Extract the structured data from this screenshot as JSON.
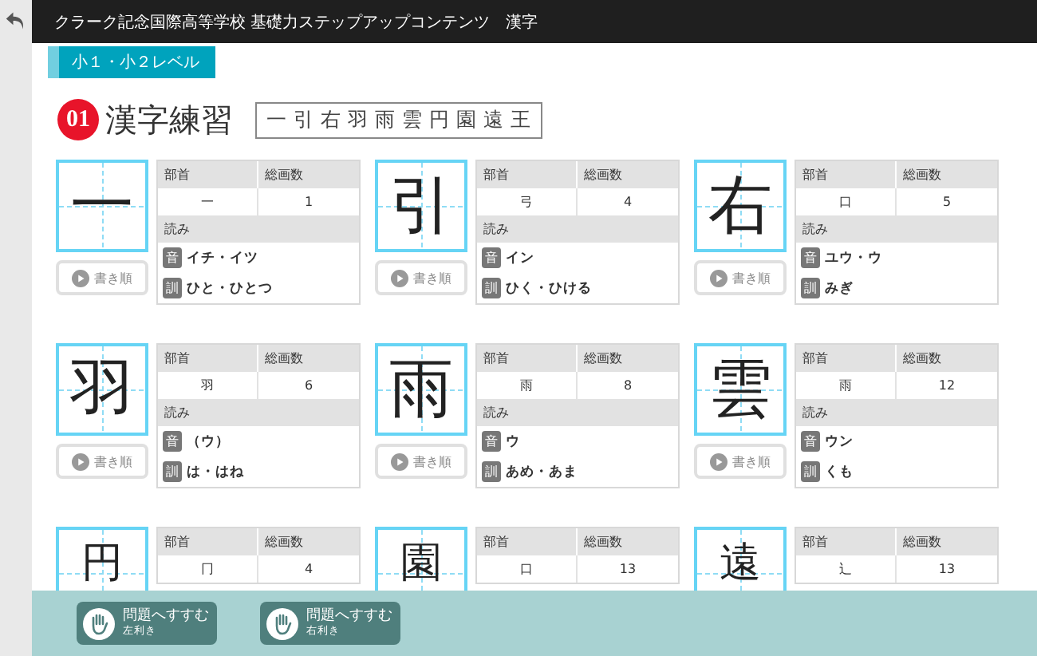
{
  "header": {
    "title": "クラーク記念国際高等学校 基礎力ステップアップコンテンツ　漢字"
  },
  "level": "小１・小２レベル",
  "lesson": {
    "number": "01",
    "title": "漢字練習",
    "kanji_list": "一 引 右 羽 雨 雲 円 園 遠 王"
  },
  "cards": [
    {
      "kanji": "一",
      "radical_label": "部首",
      "strokes_label": "総画数",
      "radical": "一",
      "strokes": "1",
      "readings_label": "読み",
      "on_label": "音",
      "on": "イチ・イツ",
      "kun_label": "訓",
      "kun": "ひと・ひとつ",
      "stroke_button": "書き順"
    },
    {
      "kanji": "引",
      "radical_label": "部首",
      "strokes_label": "総画数",
      "radical": "弓",
      "strokes": "4",
      "readings_label": "読み",
      "on_label": "音",
      "on": "イン",
      "kun_label": "訓",
      "kun": "ひく・ひける",
      "stroke_button": "書き順"
    },
    {
      "kanji": "右",
      "radical_label": "部首",
      "strokes_label": "総画数",
      "radical": "口",
      "strokes": "5",
      "readings_label": "読み",
      "on_label": "音",
      "on": "ユウ・ウ",
      "kun_label": "訓",
      "kun": "みぎ",
      "stroke_button": "書き順"
    },
    {
      "kanji": "羽",
      "radical_label": "部首",
      "strokes_label": "総画数",
      "radical": "羽",
      "strokes": "6",
      "readings_label": "読み",
      "on_label": "音",
      "on": "（ウ）",
      "kun_label": "訓",
      "kun": "は・はね",
      "stroke_button": "書き順"
    },
    {
      "kanji": "雨",
      "radical_label": "部首",
      "strokes_label": "総画数",
      "radical": "雨",
      "strokes": "8",
      "readings_label": "読み",
      "on_label": "音",
      "on": "ウ",
      "kun_label": "訓",
      "kun": "あめ・あま",
      "stroke_button": "書き順"
    },
    {
      "kanji": "雲",
      "radical_label": "部首",
      "strokes_label": "総画数",
      "radical": "雨",
      "strokes": "12",
      "readings_label": "読み",
      "on_label": "音",
      "on": "ウン",
      "kun_label": "訓",
      "kun": "くも",
      "stroke_button": "書き順"
    },
    {
      "kanji": "円",
      "radical_label": "部首",
      "strokes_label": "総画数",
      "radical": "冂",
      "strokes": "4"
    },
    {
      "kanji": "園",
      "radical_label": "部首",
      "strokes_label": "総画数",
      "radical": "口",
      "strokes": "13"
    },
    {
      "kanji": "遠",
      "radical_label": "部首",
      "strokes_label": "総画数",
      "radical": "辶",
      "strokes": "13"
    }
  ],
  "footer_buttons": [
    {
      "label": "問題へすすむ",
      "sub": "左利き"
    },
    {
      "label": "問題へすすむ",
      "sub": "右利き"
    }
  ]
}
